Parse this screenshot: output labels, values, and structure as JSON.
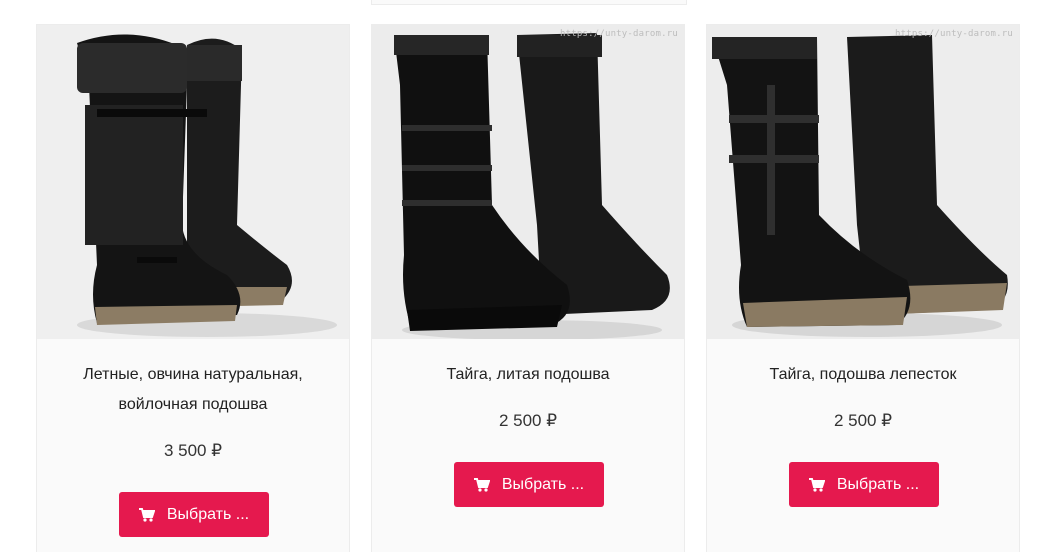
{
  "products": [
    {
      "title": "Летные, овчина натуральная, войлочная подошва",
      "price": "3 500 ₽",
      "button_label": "Выбрать ...",
      "watermark": ""
    },
    {
      "title": "Тайга, литая подошва",
      "price": "2 500 ₽",
      "button_label": "Выбрать ...",
      "watermark": "https://unty-darom.ru"
    },
    {
      "title": "Тайга, подошва лепесток",
      "price": "2 500 ₽",
      "button_label": "Выбрать ...",
      "watermark": "https://unty-darom.ru"
    }
  ],
  "icons": {
    "button_icon": "cart-icon"
  },
  "colors": {
    "button": "#e5194e",
    "card_background": "#fafafa"
  }
}
